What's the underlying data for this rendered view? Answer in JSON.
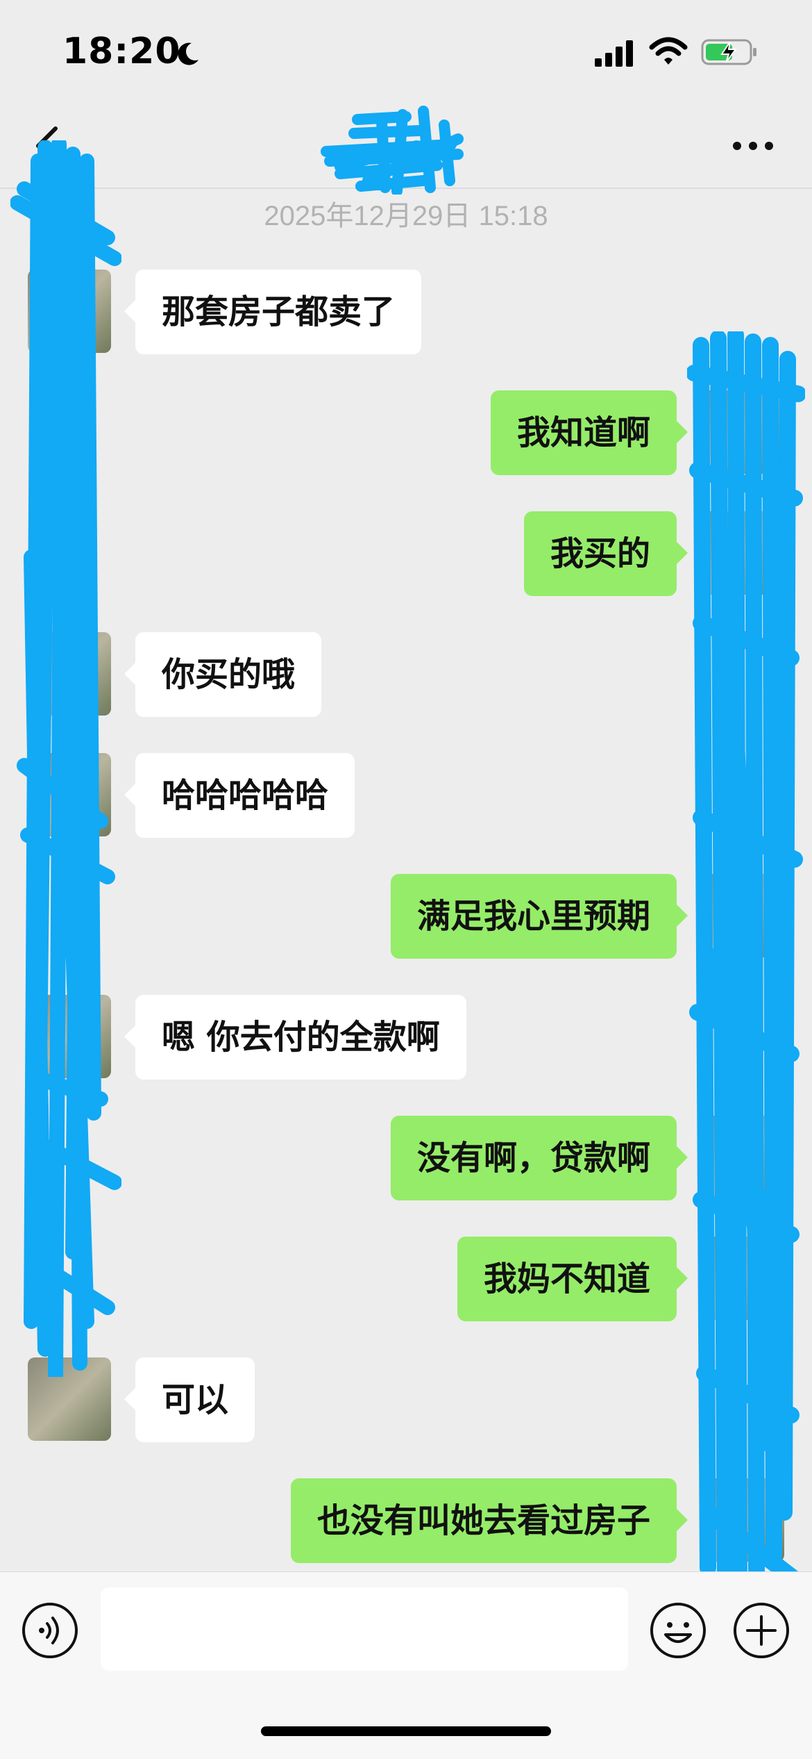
{
  "status_bar": {
    "time": "18:20",
    "icons": [
      "moon-icon",
      "signal-icon",
      "wifi-icon",
      "battery-charging-icon"
    ],
    "battery_color": "#34c759"
  },
  "nav": {
    "title": "",
    "back_icon": "chevron-left-icon",
    "more_icon": "ellipsis-icon"
  },
  "chat": {
    "timestamp": "2025年12月29日 15:18",
    "messages": [
      {
        "side": "left",
        "text": "那套房子都卖了"
      },
      {
        "side": "right",
        "text": "我知道啊"
      },
      {
        "side": "right",
        "text": "我买的"
      },
      {
        "side": "left",
        "text": "你买的哦"
      },
      {
        "side": "left",
        "text": "哈哈哈哈哈"
      },
      {
        "side": "right",
        "text": "满足我心里预期"
      },
      {
        "side": "left",
        "text": "嗯 你去付的全款啊"
      },
      {
        "side": "right",
        "text": "没有啊，贷款啊"
      },
      {
        "side": "right",
        "text": "我妈不知道"
      },
      {
        "side": "left",
        "text": "可以"
      },
      {
        "side": "right",
        "text": "也没有叫她去看过房子"
      }
    ]
  },
  "input_bar": {
    "placeholder": "",
    "icons": [
      "voice-icon",
      "emoji-icon",
      "plus-icon"
    ]
  },
  "colors": {
    "background": "#ededed",
    "sent_bubble": "#95ec69",
    "received_bubble": "#ffffff",
    "redaction": "#12a9f5"
  }
}
